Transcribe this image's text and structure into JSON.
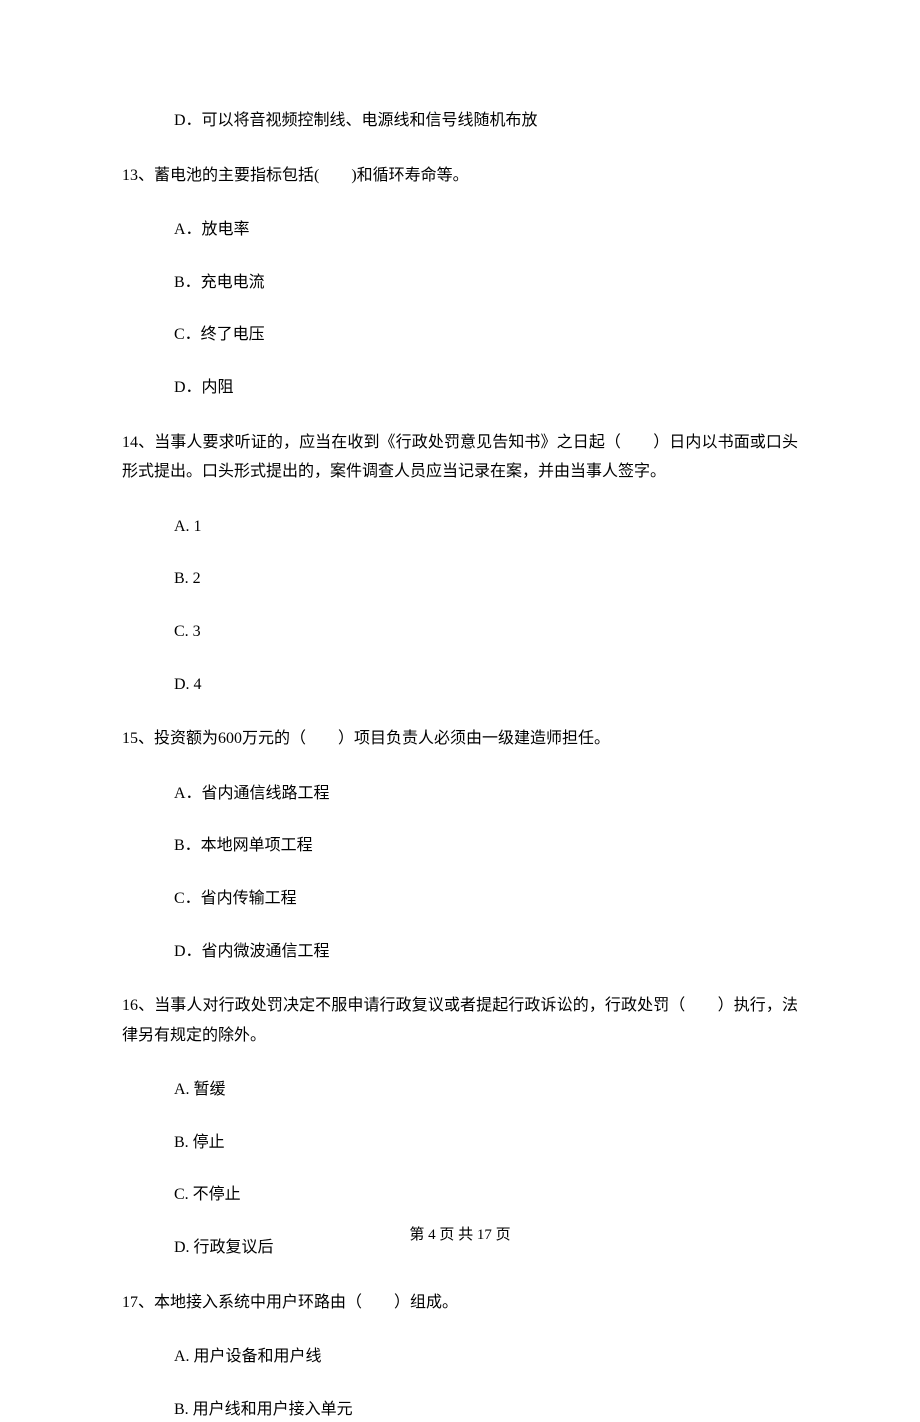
{
  "items": {
    "opt_d_random": "D．可以将音视频控制线、电源线和信号线随机布放",
    "q13": "13、蓄电池的主要指标包括(　　)和循环寿命等。",
    "q13_a": "A．放电率",
    "q13_b": "B．充电电流",
    "q13_c": "C．终了电压",
    "q13_d": "D．内阻",
    "q14": "14、当事人要求听证的，应当在收到《行政处罚意见告知书》之日起（　　）日内以书面或口头形式提出。口头形式提出的，案件调查人员应当记录在案，并由当事人签字。",
    "q14_a": "A. 1",
    "q14_b": "B. 2",
    "q14_c": "C. 3",
    "q14_d": "D. 4",
    "q15": "15、投资额为600万元的（　　）项目负责人必须由一级建造师担任。",
    "q15_a": "A．省内通信线路工程",
    "q15_b": "B．本地网单项工程",
    "q15_c": "C．省内传输工程",
    "q15_d": "D．省内微波通信工程",
    "q16": "16、当事人对行政处罚决定不服申请行政复议或者提起行政诉讼的，行政处罚（　　）执行，法律另有规定的除外。",
    "q16_a": "A. 暂缓",
    "q16_b": "B. 停止",
    "q16_c": "C. 不停止",
    "q16_d": "D. 行政复议后",
    "q17": "17、本地接入系统中用户环路由（　　）组成。",
    "q17_a": "A. 用户设备和用户线",
    "q17_b": "B. 用户线和用户接入单元"
  },
  "footer": "第 4 页 共 17 页"
}
